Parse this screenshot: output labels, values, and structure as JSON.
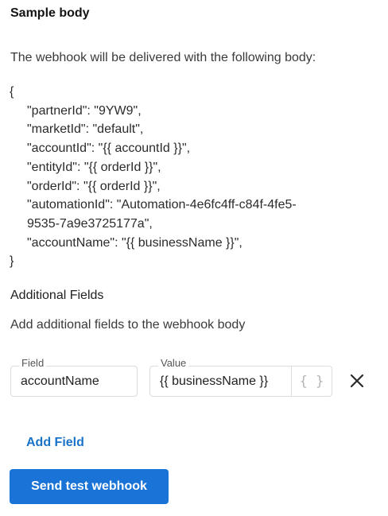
{
  "sample": {
    "title": "Sample body",
    "description": "The webhook will be delivered with the following body:",
    "open_brace": "{",
    "close_brace": "}",
    "lines": [
      "\"partnerId\": \"9YW9\",",
      "\"marketId\": \"default\",",
      "\"accountId\": \"{{ accountId }}\",",
      "\"entityId\": \"{{ orderId }}\",",
      "\"orderId\": \"{{ orderId }}\",",
      "\"automationId\": \"Automation-4e6fc4ff-c84f-4fe5-",
      "9535-7a9e3725177a\",",
      "\"accountName\": \"{{ businessName }}\","
    ]
  },
  "additional": {
    "title": "Additional Fields",
    "description": "Add additional fields to the webhook body",
    "field_label": "Field",
    "field_value": "accountName",
    "value_label": "Value",
    "value_value": "{{ businessName }}",
    "variable_icon": "{ }",
    "remove_icon": "close-x"
  },
  "actions": {
    "add_field": "Add Field",
    "send_test": "Send test webhook"
  },
  "colors": {
    "accent": "#1a73d6",
    "link": "#1a73c8"
  }
}
